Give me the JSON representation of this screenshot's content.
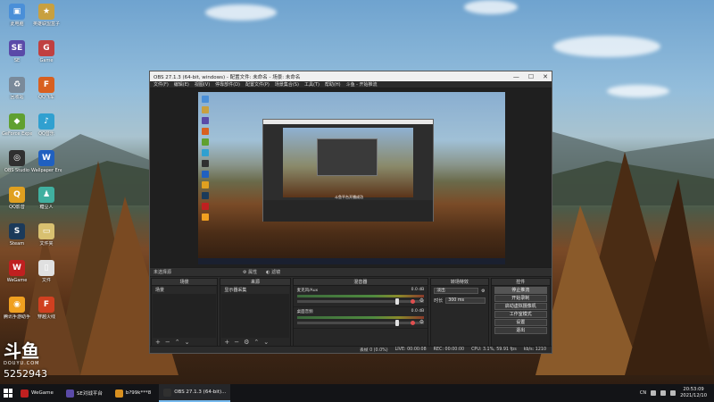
{
  "desktop": {
    "icons": [
      {
        "label": "此电脑",
        "color": "#4a8fd8",
        "glyph": "▣"
      },
      {
        "label": "英雄联盟盒子",
        "color": "#c8a040",
        "glyph": "★"
      },
      {
        "label": "SE",
        "color": "#5a4aa8",
        "glyph": "SE"
      },
      {
        "label": "Game",
        "color": "#c04040",
        "glyph": "G"
      },
      {
        "label": "回收站",
        "color": "#7a8a9a",
        "glyph": "♻"
      },
      {
        "label": "QQ飞车",
        "color": "#d86020",
        "glyph": "F"
      },
      {
        "label": "GeForce Experience",
        "color": "#60a030",
        "glyph": "◆"
      },
      {
        "label": "QQ音乐",
        "color": "#30a0d0",
        "glyph": "♪"
      },
      {
        "label": "OBS Studio",
        "color": "#303030",
        "glyph": "◎"
      },
      {
        "label": "Wallpaper Engine",
        "color": "#2060c0",
        "glyph": "W"
      },
      {
        "label": "QQ影音",
        "color": "#e0a020",
        "glyph": "Q"
      },
      {
        "label": "糖豆人",
        "color": "#40b0a0",
        "glyph": "♟"
      },
      {
        "label": "Steam",
        "color": "#1b3a5a",
        "glyph": "S"
      },
      {
        "label": "文件夹",
        "color": "#d8c070",
        "glyph": "▭"
      },
      {
        "label": "WeGame",
        "color": "#c02020",
        "glyph": "W"
      },
      {
        "label": "文件",
        "color": "#e0e0e0",
        "glyph": "▯"
      },
      {
        "label": "腾讯手游助手",
        "color": "#f0a020",
        "glyph": "◉"
      },
      {
        "label": "穿越火线",
        "color": "#d04020",
        "glyph": "F"
      }
    ]
  },
  "watermark": {
    "logo": "斗鱼",
    "sub": "DOUYU.COM",
    "room": "5252943"
  },
  "obs": {
    "title": "OBS 27.1.3 (64-bit, windows) - 配置文件: 未命名 - 场景: 未命名",
    "menu": [
      "文件(F)",
      "编辑(E)",
      "视图(V)",
      "停靠部件(D)",
      "配置文件(P)",
      "场景集合(S)",
      "工具(T)",
      "帮助(H)",
      "斗鱼 - 开始推流"
    ],
    "inner_toast": "斗鱼平台开播成功",
    "context": {
      "label": "未选择源",
      "properties": "属性",
      "filters": "滤镜"
    },
    "docks": {
      "scenes": {
        "title": "场景",
        "items": [
          "场景"
        ]
      },
      "sources": {
        "title": "来源",
        "items": [
          "显示器采集"
        ]
      },
      "mixer": {
        "title": "混音器",
        "channels": [
          {
            "name": "麦克风/Aux",
            "db": "0.0 dB",
            "level": 0.93
          },
          {
            "name": "桌面音频",
            "db": "0.0 dB",
            "level": 0.93
          }
        ]
      },
      "transitions": {
        "title": "转场特效",
        "type": "淡出",
        "duration_label": "时长",
        "duration": "300 ms"
      },
      "controls": {
        "title": "控件",
        "buttons": [
          "停止推流",
          "开始录制",
          "启动虚拟摄像机",
          "工作室模式",
          "设置",
          "退出"
        ]
      }
    },
    "status": {
      "dropped": "丢帧 0 (0.0%)",
      "live": "LIVE: 00:00:08",
      "rec": "REC: 00:00:00",
      "cpu": "CPU: 3.1%, 59.91 fps",
      "bitrate": "kb/s: 1210"
    }
  },
  "taskbar": {
    "items": [
      {
        "label": "WeGame",
        "color": "#c02020",
        "active": false
      },
      {
        "label": "SE对战平台",
        "color": "#5a4aa8",
        "active": false
      },
      {
        "label": "b?99k***8",
        "color": "#d89020",
        "active": false
      },
      {
        "label": "OBS 27.1.3 (64-bit)...",
        "color": "#303030",
        "active": true
      }
    ],
    "tray_text": "CN",
    "time": "20:53:09",
    "date": "2021/12/10"
  }
}
